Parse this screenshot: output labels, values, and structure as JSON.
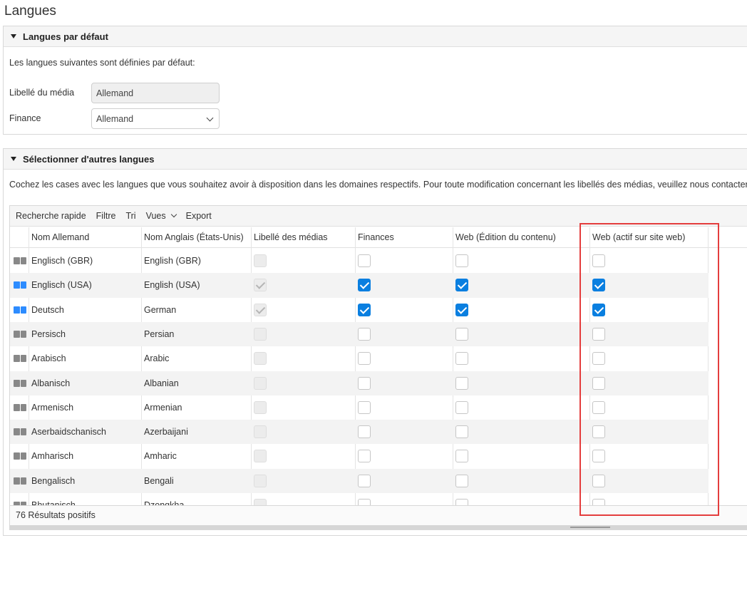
{
  "page_title": "Langues",
  "default_panel": {
    "title": "Langues par défaut",
    "intro": "Les langues suivantes sont définies par défaut:",
    "fields": [
      {
        "label": "Libellé du média",
        "value": "Allemand",
        "type": "readonly"
      },
      {
        "label": "Finance",
        "value": "Allemand",
        "type": "select"
      }
    ]
  },
  "other_panel": {
    "title": "Sélectionner d'autres langues",
    "intro": "Cochez les cases avec les langues que vous souhaitez avoir à disposition dans les domaines respectifs. Pour toute modification concernant les libellés des médias, veuillez nous contacter."
  },
  "toolbar": {
    "quick_search": "Recherche rapide",
    "filter": "Filtre",
    "sort": "Tri",
    "views": "Vues",
    "export": "Export"
  },
  "columns": [
    "Nom Allemand",
    "Nom Anglais (États-Unis)",
    "Libellé des médias",
    "Finances",
    "Web (Édition du contenu)",
    "Web (actif sur site web)"
  ],
  "rows": [
    {
      "de": "Englisch (GBR)",
      "en": "English (GBR)",
      "active": false,
      "media": false,
      "finance": false,
      "web_edit": false,
      "web_live": false
    },
    {
      "de": "Englisch (USA)",
      "en": "English (USA)",
      "active": true,
      "media": true,
      "finance": true,
      "web_edit": true,
      "web_live": true
    },
    {
      "de": "Deutsch",
      "en": "German",
      "active": true,
      "media": true,
      "finance": true,
      "web_edit": true,
      "web_live": true
    },
    {
      "de": "Persisch",
      "en": "Persian",
      "active": false,
      "media": false,
      "finance": false,
      "web_edit": false,
      "web_live": false
    },
    {
      "de": "Arabisch",
      "en": "Arabic",
      "active": false,
      "media": false,
      "finance": false,
      "web_edit": false,
      "web_live": false
    },
    {
      "de": "Albanisch",
      "en": "Albanian",
      "active": false,
      "media": false,
      "finance": false,
      "web_edit": false,
      "web_live": false
    },
    {
      "de": "Armenisch",
      "en": "Armenian",
      "active": false,
      "media": false,
      "finance": false,
      "web_edit": false,
      "web_live": false
    },
    {
      "de": "Aserbaidschanisch",
      "en": "Azerbaijani",
      "active": false,
      "media": false,
      "finance": false,
      "web_edit": false,
      "web_live": false
    },
    {
      "de": "Amharisch",
      "en": "Amharic",
      "active": false,
      "media": false,
      "finance": false,
      "web_edit": false,
      "web_live": false
    },
    {
      "de": "Bengalisch",
      "en": "Bengali",
      "active": false,
      "media": false,
      "finance": false,
      "web_edit": false,
      "web_live": false
    },
    {
      "de": "Bhutanisch",
      "en": "Dzongkha",
      "active": false,
      "media": false,
      "finance": false,
      "web_edit": false,
      "web_live": false
    }
  ],
  "footer": {
    "results": "76 Résultats positifs"
  },
  "colors": {
    "accent": "#0a7fe0",
    "highlight": "#e43d3d"
  },
  "icons": {
    "language_flag": "language-translate-icon",
    "expand": "triangle-down-icon"
  }
}
